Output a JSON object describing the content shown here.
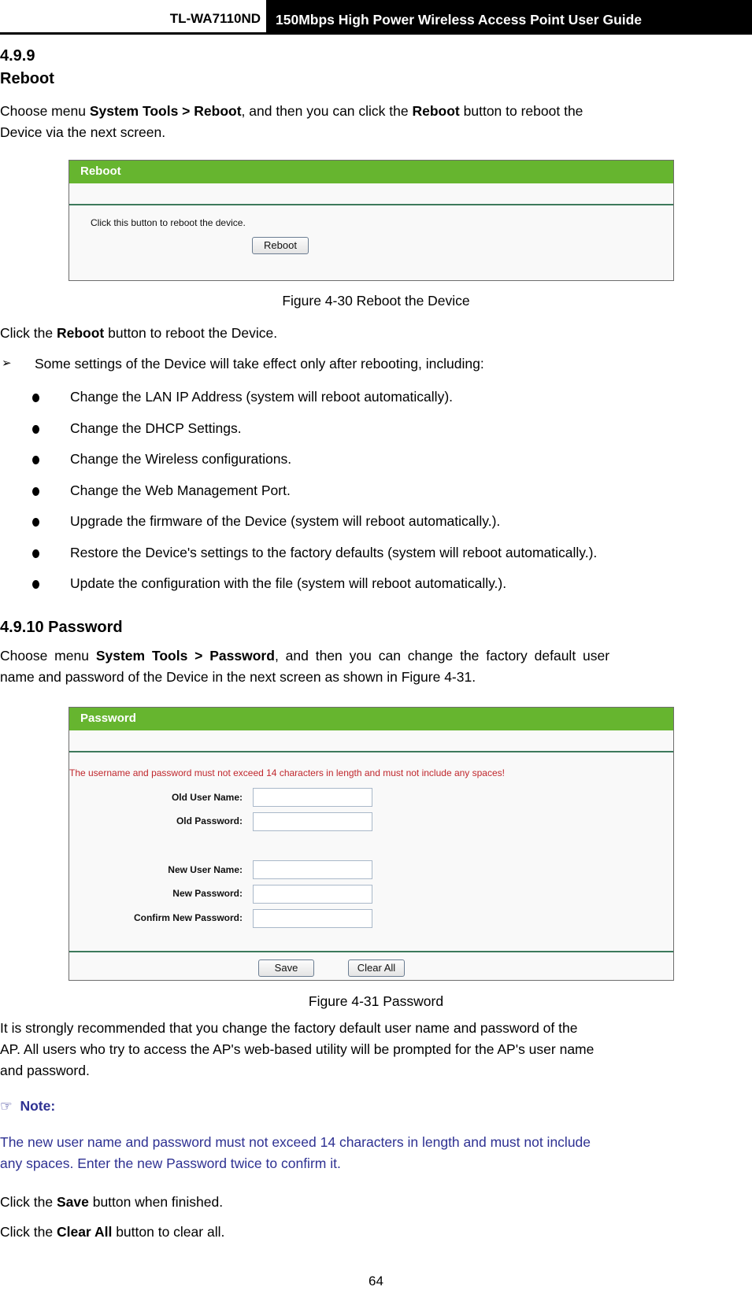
{
  "header": {
    "model": "TL-WA7110ND",
    "title": "150Mbps High Power Wireless Access Point User Guide"
  },
  "section_reboot": {
    "number": "4.9.9",
    "title": "Reboot",
    "intro": {
      "pre": "Choose menu ",
      "menu": "System Tools > Reboot",
      "mid": ", and then you can click the ",
      "btn": "Reboot",
      "post": " button to reboot the",
      "line2": "Device via the next screen."
    },
    "figure": {
      "header": "Reboot",
      "instruction": "Click this button to reboot the device.",
      "button_label": "Reboot"
    },
    "caption": "Figure 4-30 Reboot the Device",
    "click_line": {
      "pre": "Click the ",
      "bold": "Reboot",
      "post": " button to reboot the Device."
    },
    "arrow_item": "Some settings of the Device will take effect only after rebooting, including:",
    "bullets": [
      "Change the LAN IP Address (system will reboot automatically).",
      "Change the DHCP Settings.",
      "Change the Wireless configurations.",
      "Change the Web Management Port.",
      "Upgrade the firmware of the Device (system will reboot automatically.).",
      "Restore the Device's settings to the factory defaults (system will reboot automatically.).",
      "Update the configuration with the file (system will reboot automatically.)."
    ]
  },
  "section_password": {
    "number_title": "4.9.10 Password",
    "intro": {
      "pre": "Choose menu ",
      "menu": "System Tools > Password",
      "post": ", and then you can change the factory default user",
      "line2": "name and password of the Device in the next screen as shown in Figure 4-31."
    },
    "figure": {
      "header": "Password",
      "warning": "The username and password must not exceed 14 characters in length and must not include any spaces!",
      "fields": [
        {
          "label": "Old User Name:",
          "value": ""
        },
        {
          "label": "Old Password:",
          "value": ""
        },
        {
          "label": "New User Name:",
          "value": ""
        },
        {
          "label": "New Password:",
          "value": ""
        },
        {
          "label": "Confirm New Password:",
          "value": ""
        }
      ],
      "save_label": "Save",
      "clear_label": "Clear All"
    },
    "caption": "Figure 4-31 Password",
    "recommend": [
      "It is strongly recommended that you change the factory default user name and password of the",
      "AP. All users who try to access the AP's web-based utility will be prompted for the AP's user name",
      "and password."
    ],
    "note": {
      "icon": "☞",
      "label": "Note:",
      "lines": [
        "The new user name and password must not exceed 14 characters in length and must not include",
        "any spaces. Enter the new Password twice to confirm it."
      ]
    },
    "save_line": {
      "pre": "Click the ",
      "bold": "Save",
      "post": " button when finished."
    },
    "clear_line": {
      "pre": "Click the ",
      "bold": "Clear All",
      "post": " button to clear all."
    }
  },
  "page_number": "64",
  "colors": {
    "green_header": "#66b52f",
    "warning_red": "#c0272d",
    "note_blue": "#2e3192"
  }
}
